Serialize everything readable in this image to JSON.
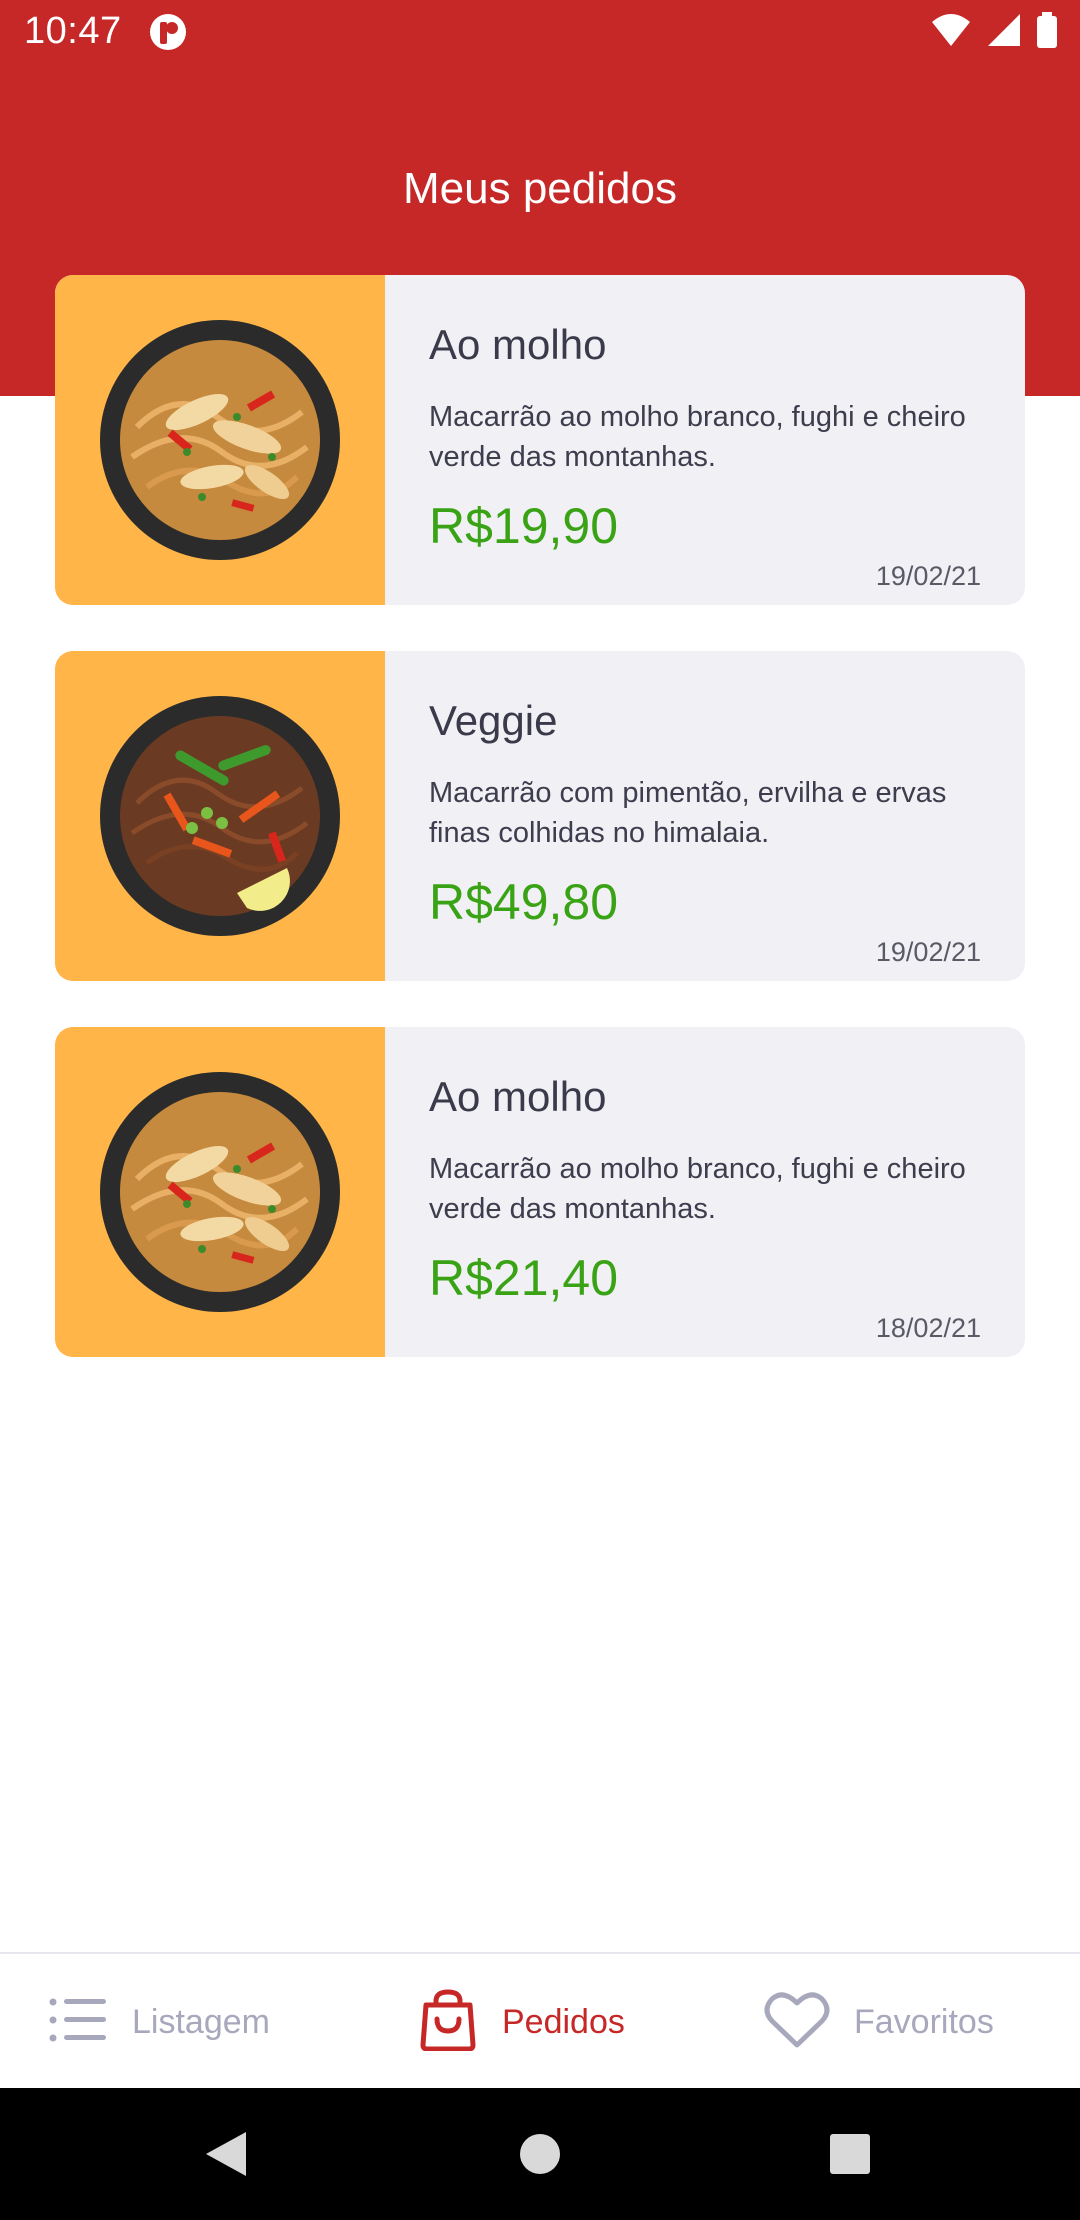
{
  "status_bar": {
    "time": "10:47",
    "icons": [
      "app-notification-icon",
      "wifi-icon",
      "signal-icon",
      "battery-icon"
    ]
  },
  "header": {
    "title": "Meus pedidos"
  },
  "orders": [
    {
      "name": "Ao molho",
      "description": "Macarrão ao molho branco, fughi e cheiro verde das montanhas.",
      "price": "R$19,90",
      "date": "19/02/21",
      "image": "chicken-noodles-bowl"
    },
    {
      "name": "Veggie",
      "description": "Macarrão com pimentão, ervilha e ervas finas colhidas no himalaia.",
      "price": "R$49,80",
      "date": "19/02/21",
      "image": "veggie-noodles-bowl"
    },
    {
      "name": "Ao molho",
      "description": "Macarrão ao molho branco, fughi e cheiro verde das montanhas.",
      "price": "R$21,40",
      "date": "18/02/21",
      "image": "chicken-noodles-bowl"
    }
  ],
  "bottom_nav": {
    "items": [
      {
        "label": "Listagem",
        "icon": "list-icon",
        "active": false
      },
      {
        "label": "Pedidos",
        "icon": "shopping-bag-icon",
        "active": true
      },
      {
        "label": "Favoritos",
        "icon": "heart-icon",
        "active": false
      }
    ]
  },
  "colors": {
    "brand_red": "#c62828",
    "thumb_orange": "#ffb547",
    "price_green": "#3aa315",
    "card_bg": "#f0f0f5",
    "inactive_nav": "#a8a8bd"
  }
}
